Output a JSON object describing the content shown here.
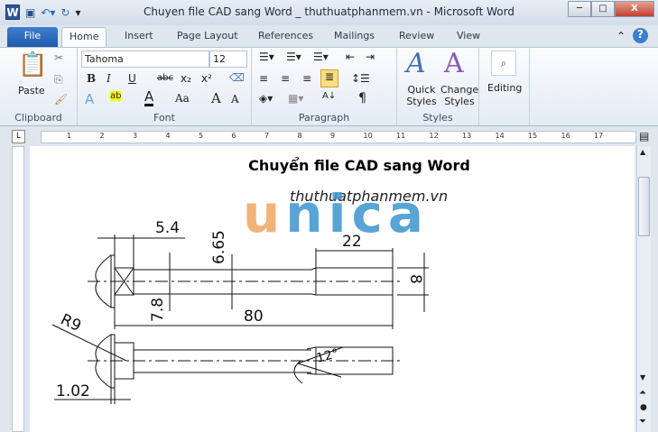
{
  "window": {
    "title": "Chuyen file CAD sang Word _ thuthuatphanmem.vn  -  Microsoft Word",
    "app_icon": "W",
    "minimize": "─",
    "maximize": "□",
    "close": "X"
  },
  "tabs": [
    "File",
    "Home",
    "Insert",
    "Page Layout",
    "References",
    "Mailings",
    "Review",
    "View"
  ],
  "ribbon": {
    "clipboard": {
      "paste": "Paste",
      "label": "Clipboard"
    },
    "font": {
      "name": "Tahoma",
      "size": "12",
      "bold": "B",
      "italic": "I",
      "underline": "U",
      "strike": "abc",
      "sub": "x₂",
      "sup": "x²",
      "grow": "A",
      "shrink": "A",
      "case": "Aa",
      "highlight": "ab",
      "color": "A",
      "effects": "A",
      "label": "Font"
    },
    "paragraph": {
      "label": "Paragraph",
      "pilcrow": "¶"
    },
    "styles": {
      "quick": "Quick Styles",
      "change": "Change Styles",
      "label": "Styles"
    },
    "editing": {
      "label": "Editing"
    }
  },
  "ruler": {
    "numbers": [
      "1",
      "2",
      "3",
      "4",
      "5",
      "6",
      "7",
      "8",
      "9",
      "10",
      "11",
      "12",
      "13",
      "14",
      "15",
      "16",
      "17"
    ]
  },
  "document": {
    "heading": "Chuyển file CAD sang Word",
    "watermark_site": "thuthuatphanmem.vn",
    "watermark_brand": "unica",
    "dims": {
      "d1": "5.4",
      "d2": "6.65",
      "d3": "22",
      "d4": "8",
      "d5": "7.8",
      "d6": "80",
      "d7": "R9",
      "d8": "1.02",
      "d9": "12°"
    }
  }
}
